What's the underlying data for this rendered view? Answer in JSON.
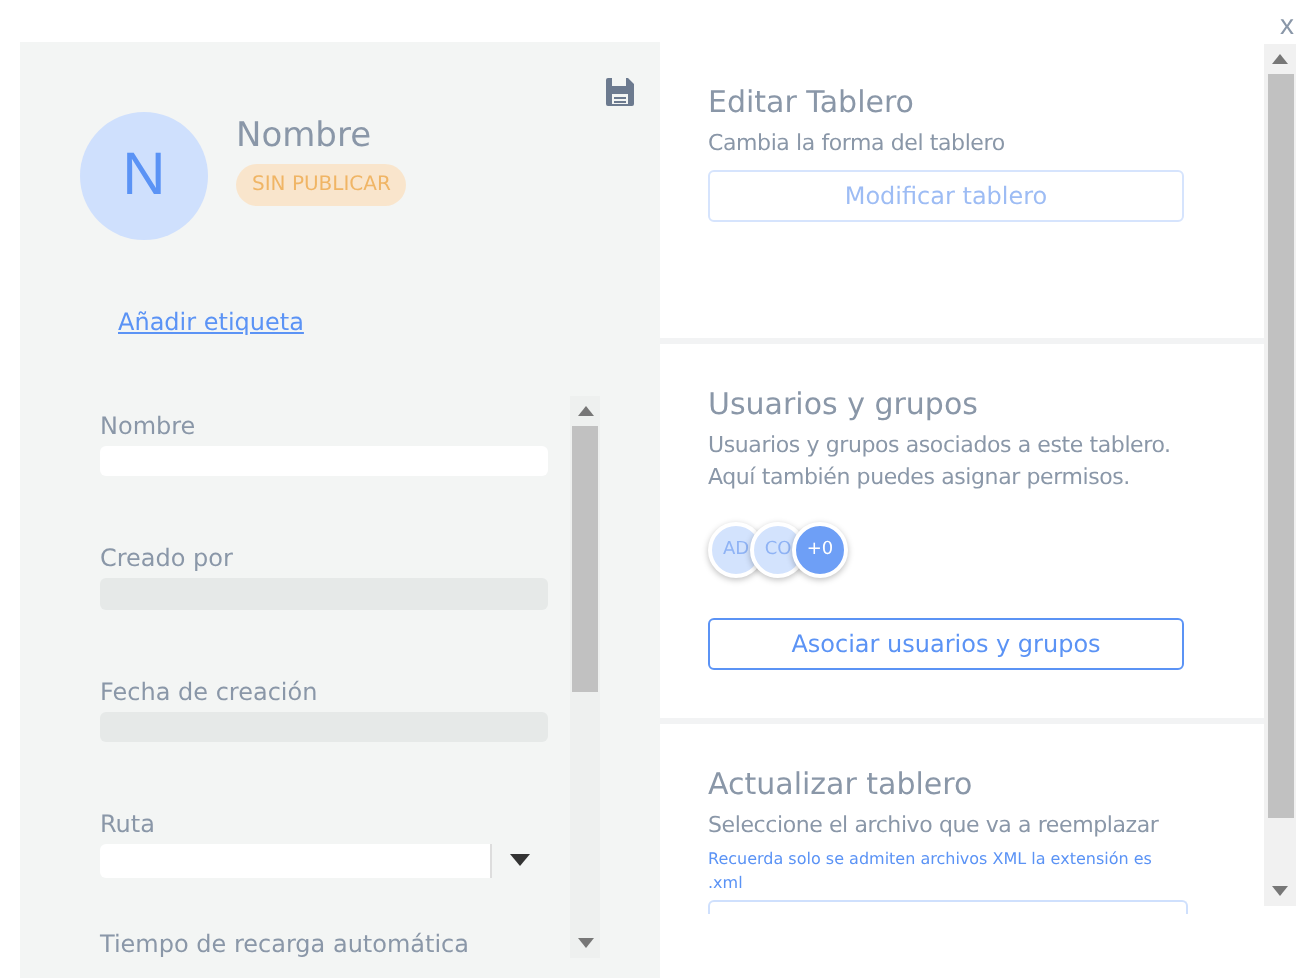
{
  "close_label": "x",
  "profile": {
    "initial": "N",
    "name": "Nombre",
    "status": "SIN PUBLICAR",
    "add_tag_link": "Añadir etiqueta"
  },
  "form_fields": [
    {
      "label": "Nombre",
      "kind": "text",
      "disabled": false
    },
    {
      "label": "Creado por",
      "kind": "text",
      "disabled": true
    },
    {
      "label": "Fecha de creación",
      "kind": "text",
      "disabled": true
    },
    {
      "label": "Ruta",
      "kind": "select",
      "disabled": false
    },
    {
      "label": "Tiempo de recarga automática",
      "kind": "label"
    }
  ],
  "sections": [
    {
      "title": "Editar Tablero",
      "description": "Cambia la forma del tablero",
      "button": {
        "label": "Modificar tablero",
        "disabled": true
      }
    },
    {
      "title": "Usuarios y grupos",
      "description": "Usuarios y grupos asociados a este tablero. Aquí también puedes asignar permisos.",
      "avatars": [
        {
          "text": "AD",
          "kind": "member"
        },
        {
          "text": "CO",
          "kind": "member"
        },
        {
          "text": "+0",
          "kind": "more"
        }
      ],
      "button": {
        "label": "Asociar usuarios y grupos",
        "disabled": false
      }
    },
    {
      "title": "Actualizar tablero",
      "description": "Seleccione el archivo que va a reemplazar",
      "note": "Recuerda solo se admiten archivos XML la extensión es .xml",
      "file_field": true
    }
  ]
}
